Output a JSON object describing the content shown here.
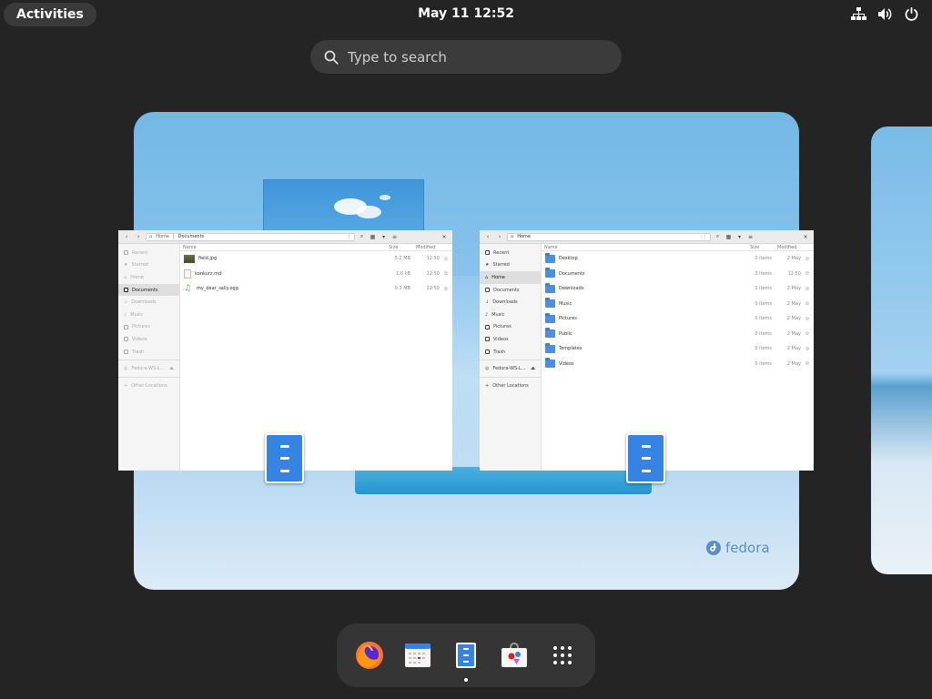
{
  "topbar": {
    "activities_label": "Activities",
    "clock": "May 11  12:52",
    "tray_icons": [
      "network-icon",
      "volume-icon",
      "power-icon"
    ]
  },
  "search": {
    "placeholder": "Type to search"
  },
  "wallpaper": {
    "brand": "fedora"
  },
  "windows": {
    "documents": {
      "path_home": "Home",
      "path_current": "Documents",
      "sidebar": [
        "Recent",
        "Starred",
        "Home",
        "Documents",
        "Downloads",
        "Music",
        "Pictures",
        "Videos",
        "Trash",
        "Fedora-WS-L...",
        "Other Locations"
      ],
      "columns": {
        "name": "Name",
        "size": "Size",
        "modified": "Modified"
      },
      "files": [
        {
          "name": "field.jpg",
          "size": "5.2 MB",
          "modified": "12:50",
          "icon": "image-icon"
        },
        {
          "name": "konkurz.md",
          "size": "1.6 kB",
          "modified": "12:50",
          "icon": "text-file-icon"
        },
        {
          "name": "my_dear_sally.ogg",
          "size": "9.3 MB",
          "modified": "12:50",
          "icon": "music-file-icon"
        }
      ]
    },
    "home": {
      "path_current": "Home",
      "sidebar": [
        "Recent",
        "Starred",
        "Home",
        "Documents",
        "Downloads",
        "Music",
        "Pictures",
        "Videos",
        "Trash",
        "Fedora-WS-L...",
        "Other Locations"
      ],
      "columns": {
        "name": "Name",
        "size": "Size",
        "modified": "Modified"
      },
      "folders": [
        {
          "name": "Desktop",
          "size": "0 items",
          "modified": "2 May"
        },
        {
          "name": "Documents",
          "size": "3 items",
          "modified": "12:50"
        },
        {
          "name": "Downloads",
          "size": "0 items",
          "modified": "2 May"
        },
        {
          "name": "Music",
          "size": "0 items",
          "modified": "2 May"
        },
        {
          "name": "Pictures",
          "size": "0 items",
          "modified": "2 May"
        },
        {
          "name": "Public",
          "size": "0 items",
          "modified": "2 May"
        },
        {
          "name": "Templates",
          "size": "0 items",
          "modified": "2 May"
        },
        {
          "name": "Videos",
          "size": "0 items",
          "modified": "2 May"
        }
      ]
    }
  },
  "dash": {
    "apps": [
      "firefox-icon",
      "calendar-icon",
      "files-icon",
      "software-icon",
      "app-grid-icon"
    ],
    "running": "files-icon"
  },
  "colors": {
    "panel": "#242424",
    "accent": "#3584e4"
  }
}
